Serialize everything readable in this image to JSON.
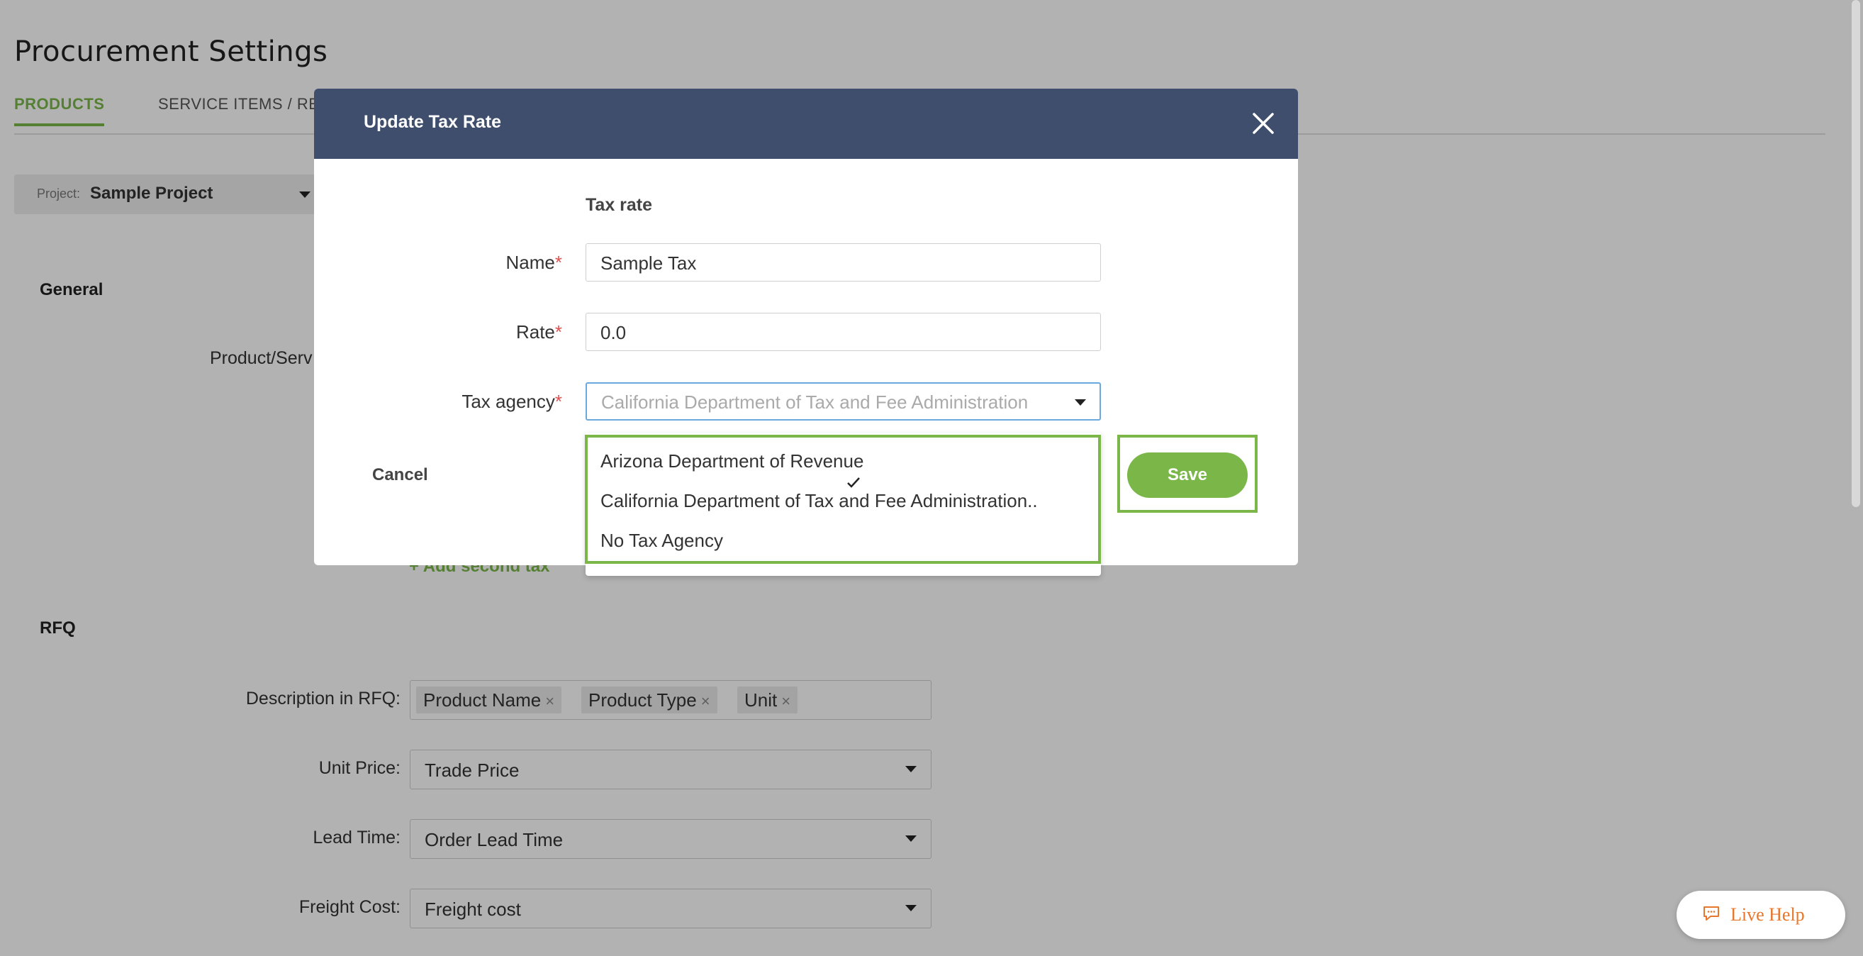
{
  "page": {
    "title": "Procurement Settings",
    "tabs": [
      {
        "label": "PRODUCTS",
        "active": true
      },
      {
        "label": "SERVICE ITEMS / RE",
        "active": false
      }
    ],
    "project": {
      "label": "Project:",
      "value": "Sample Project"
    },
    "general": {
      "heading": "General",
      "product_service_label": "Product/Serv",
      "add_second_tax": "+ Add second tax"
    },
    "rfq": {
      "heading": "RFQ",
      "description_label": "Description in RFQ:",
      "description_chips": [
        "Product Name",
        "Product Type",
        "Unit"
      ],
      "unit_price_label": "Unit Price:",
      "unit_price_value": "Trade Price",
      "lead_time_label": "Lead Time:",
      "lead_time_value": "Order Lead Time",
      "freight_cost_label": "Freight Cost:",
      "freight_cost_value": "Freight cost"
    },
    "live_help": {
      "label": "Live Help",
      "icon": "chat-bubble-icon"
    }
  },
  "modal": {
    "title": "Update Tax Rate",
    "close_icon": "close-icon",
    "subheading": "Tax rate",
    "name_label": "Name",
    "name_value": "Sample Tax",
    "rate_label": "Rate",
    "rate_value": "0.0",
    "agency_label": "Tax agency",
    "agency_value": "California Department of Tax and Fee Administration",
    "required_mark": "*",
    "dropdown_options": [
      {
        "label": "Arizona Department of Revenue",
        "selected": false
      },
      {
        "label": "California Department of Tax and Fee Administration..",
        "selected": true
      },
      {
        "label": "No Tax Agency",
        "selected": false
      }
    ],
    "cancel_label": "Cancel",
    "save_label": "Save"
  },
  "colors": {
    "accent_green": "#7ab648",
    "modal_header": "#3f4e6c",
    "required_red": "#e05050",
    "live_help_orange": "#e8772e"
  }
}
